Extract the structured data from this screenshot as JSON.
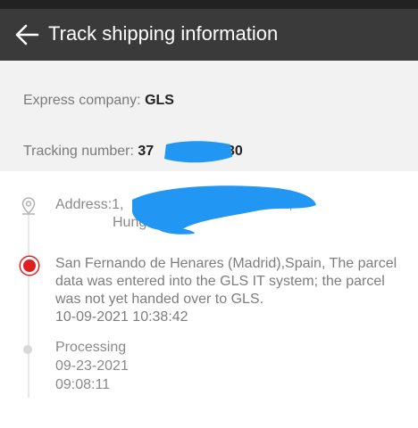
{
  "header": {
    "title": "Track shipping information",
    "back_icon": "back-arrow-icon"
  },
  "summary": {
    "company_label": "Express company: ",
    "company_value": "GLS",
    "tracking_label": "Tracking number: ",
    "tracking_prefix": "37",
    "tracking_suffix": "30",
    "redaction_color": "#2196f3"
  },
  "timeline": {
    "address": {
      "prefix": "Address:1,",
      "line1_tail": "est,",
      "line2": "Hung"
    },
    "events": [
      {
        "text": "San Fernando de Henares (Madrid),Spain, The parcel data was entered into the GLS IT system; the parcel was not yet handed over to GLS.",
        "time": "10-09-2021 10:38:42",
        "active": true
      },
      {
        "status": "Processing",
        "date": "09-23-2021",
        "time": "09:08:11",
        "active": false
      }
    ],
    "active_color": "#e02020"
  }
}
